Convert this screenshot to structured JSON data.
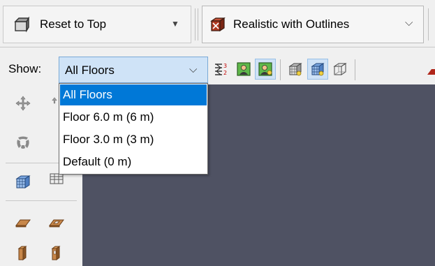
{
  "toolbar": {
    "reset_label": "Reset to Top",
    "render_style": "Realistic with Outlines"
  },
  "floor_filter": {
    "label": "Show:",
    "selected": "All Floors",
    "options": [
      "All Floors",
      "Floor 6.0 m (6 m)",
      "Floor 3.0 m (3 m)",
      "Default (0 m)"
    ]
  },
  "colors": {
    "viewport_bg": "#4f5263",
    "selection": "#0078d7",
    "combo_focus": "#cfe3f7"
  },
  "icons": {
    "reset": "reset-view-icon",
    "render_style": "render-style-icon",
    "toolbar_row2": [
      "floor-stack-icon",
      "person-green-icon",
      "person-green-pressed-icon",
      "wireframe-light-icon",
      "wireframe-light-pressed-icon",
      "wireframe-outline-icon"
    ],
    "left_bar": [
      "pan-icon",
      "orbit-icon",
      "wireframe-cube-icon",
      "grid-icon",
      "slab-icon",
      "opening-slab-icon",
      "column-icon",
      "column-window-icon"
    ]
  }
}
